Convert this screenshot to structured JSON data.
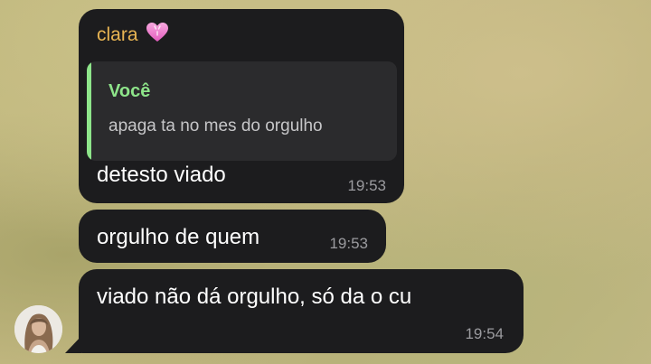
{
  "chat": {
    "messages": [
      {
        "sender": "clara",
        "sender_badge_icon": "pink-heart-icon",
        "reply_to": {
          "author": "Você",
          "text": "apaga ta no mes do orgulho"
        },
        "text": "detesto viado",
        "time": "19:53"
      },
      {
        "text": "orgulho de quem",
        "time": "19:53"
      },
      {
        "text": "viado não dá orgulho, só da o cu",
        "time": "19:54"
      }
    ],
    "avatar_icon": "contact-avatar"
  },
  "colors": {
    "bubble": "#1c1c1e",
    "sender_name": "#e7b453",
    "reply_accent": "#8ee58a",
    "timestamp": "#9b9b9f"
  }
}
